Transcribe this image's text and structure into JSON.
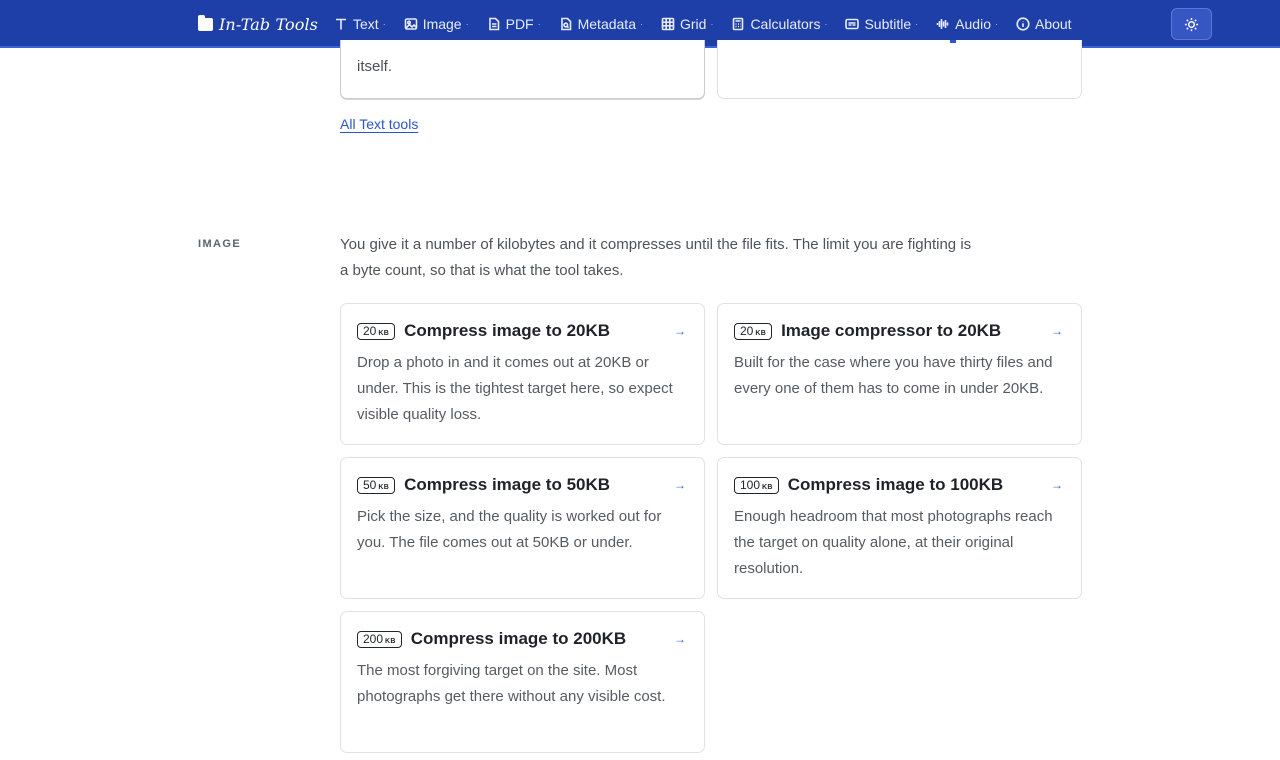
{
  "brand": {
    "name": "In-Tab Tools"
  },
  "nav": [
    {
      "label": "Text",
      "icon": "text-icon"
    },
    {
      "label": "Image",
      "icon": "image-icon"
    },
    {
      "label": "PDF",
      "icon": "pdf-icon"
    },
    {
      "label": "Metadata",
      "icon": "metadata-icon"
    },
    {
      "label": "Grid",
      "icon": "grid-icon"
    },
    {
      "label": "Calculators",
      "icon": "calculator-icon"
    },
    {
      "label": "Subtitle",
      "icon": "subtitle-icon"
    },
    {
      "label": "Audio",
      "icon": "audio-icon"
    },
    {
      "label": "About",
      "icon": "info-icon"
    }
  ],
  "theme_toggle": {
    "icon": "sun-icon"
  },
  "previous_section": {
    "card_left_tail": "itself.",
    "all_link": "All Text tools"
  },
  "image_section": {
    "label": "IMAGE",
    "intro": "You give it a number of kilobytes and it compresses until the file fits. The limit you are fighting is a byte count, so that is what the tool takes.",
    "cards": [
      {
        "size": "20",
        "unit": "KB",
        "title": "Compress image to 20KB",
        "desc": "Drop a photo in and it comes out at 20KB or under. This is the tightest target here, so expect visible quality loss.",
        "arrow": "→"
      },
      {
        "size": "20",
        "unit": "KB",
        "title": "Image compressor to 20KB",
        "desc": "Built for the case where you have thirty files and every one of them has to come in under 20KB.",
        "arrow": "→"
      },
      {
        "size": "50",
        "unit": "KB",
        "title": "Compress image to 50KB",
        "desc": "Pick the size, and the quality is worked out for you. The file comes out at 50KB or under.",
        "arrow": "→"
      },
      {
        "size": "100",
        "unit": "KB",
        "title": "Compress image to 100KB",
        "desc": "Enough headroom that most photographs reach the target on quality alone, at their original resolution.",
        "arrow": "→"
      },
      {
        "size": "200",
        "unit": "KB",
        "title": "Compress image to 200KB",
        "desc": "The most forgiving target on the site. Most photographs get there without any visible cost.",
        "arrow": "→"
      }
    ]
  },
  "colors": {
    "nav_bg": "#1e3fa8",
    "accent": "#2b55d6"
  }
}
